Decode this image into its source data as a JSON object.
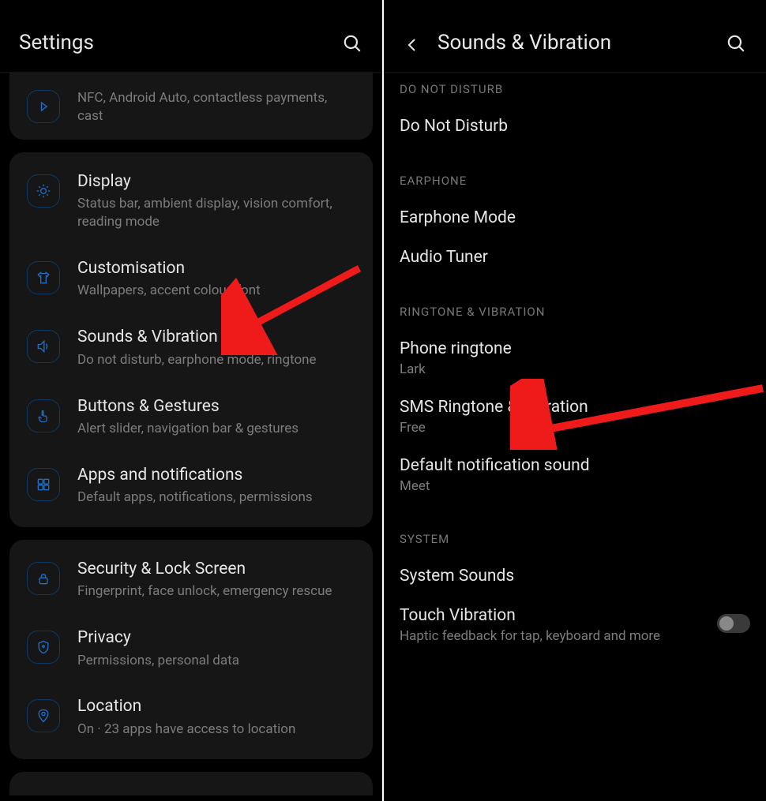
{
  "left": {
    "header": {
      "title": "Settings"
    },
    "cards": [
      {
        "kind": "first",
        "rows": [
          {
            "icon": "nfc",
            "title_hidden": "",
            "sub_trunc": "NFC, Android Auto, contactless payments, cast"
          }
        ]
      },
      {
        "kind": "mid",
        "rows": [
          {
            "icon": "display",
            "title": "Display",
            "sub": "Status bar, ambient display, vision comfort, reading mode"
          },
          {
            "icon": "customisation",
            "title": "Customisation",
            "sub": "Wallpapers, accent colour, font"
          },
          {
            "icon": "sound",
            "title": "Sounds & Vibration",
            "sub": "Do not disturb, earphone mode, ringtone"
          },
          {
            "icon": "gesture",
            "title": "Buttons & Gestures",
            "sub": "Alert slider, navigation bar & gestures"
          },
          {
            "icon": "apps",
            "title": "Apps and notifications",
            "sub": "Default apps, notifications, permissions"
          }
        ]
      },
      {
        "kind": "mid",
        "rows": [
          {
            "icon": "lock",
            "title": "Security & Lock Screen",
            "sub": "Fingerprint, face unlock, emergency rescue"
          },
          {
            "icon": "privacy",
            "title": "Privacy",
            "sub": "Permissions, personal data"
          },
          {
            "icon": "location",
            "title": "Location",
            "sub": "On · 23 apps have access to location"
          }
        ]
      },
      {
        "kind": "last",
        "rows": []
      }
    ]
  },
  "right": {
    "header": {
      "title": "Sounds & Vibration"
    },
    "sections": [
      {
        "label": "DO NOT DISTURB",
        "cut": true,
        "items": [
          {
            "title": "Do Not Disturb"
          }
        ]
      },
      {
        "label": "EARPHONE",
        "items": [
          {
            "title": "Earphone Mode"
          },
          {
            "title": "Audio Tuner"
          }
        ]
      },
      {
        "label": "RINGTONE & VIBRATION",
        "items": [
          {
            "title": "Phone ringtone",
            "sub": "Lark"
          },
          {
            "title": "SMS Ringtone & Vibration",
            "sub": "Free"
          },
          {
            "title": "Default notification sound",
            "sub": "Meet"
          }
        ]
      },
      {
        "label": "SYSTEM",
        "items": [
          {
            "title": "System Sounds"
          },
          {
            "title": "Touch Vibration",
            "sub": "Haptic feedback for tap, keyboard and more",
            "toggle": false
          }
        ]
      }
    ]
  },
  "annotations": {
    "arrow1_target": "Sounds & Vibration",
    "arrow2_target": "Phone ringtone"
  }
}
